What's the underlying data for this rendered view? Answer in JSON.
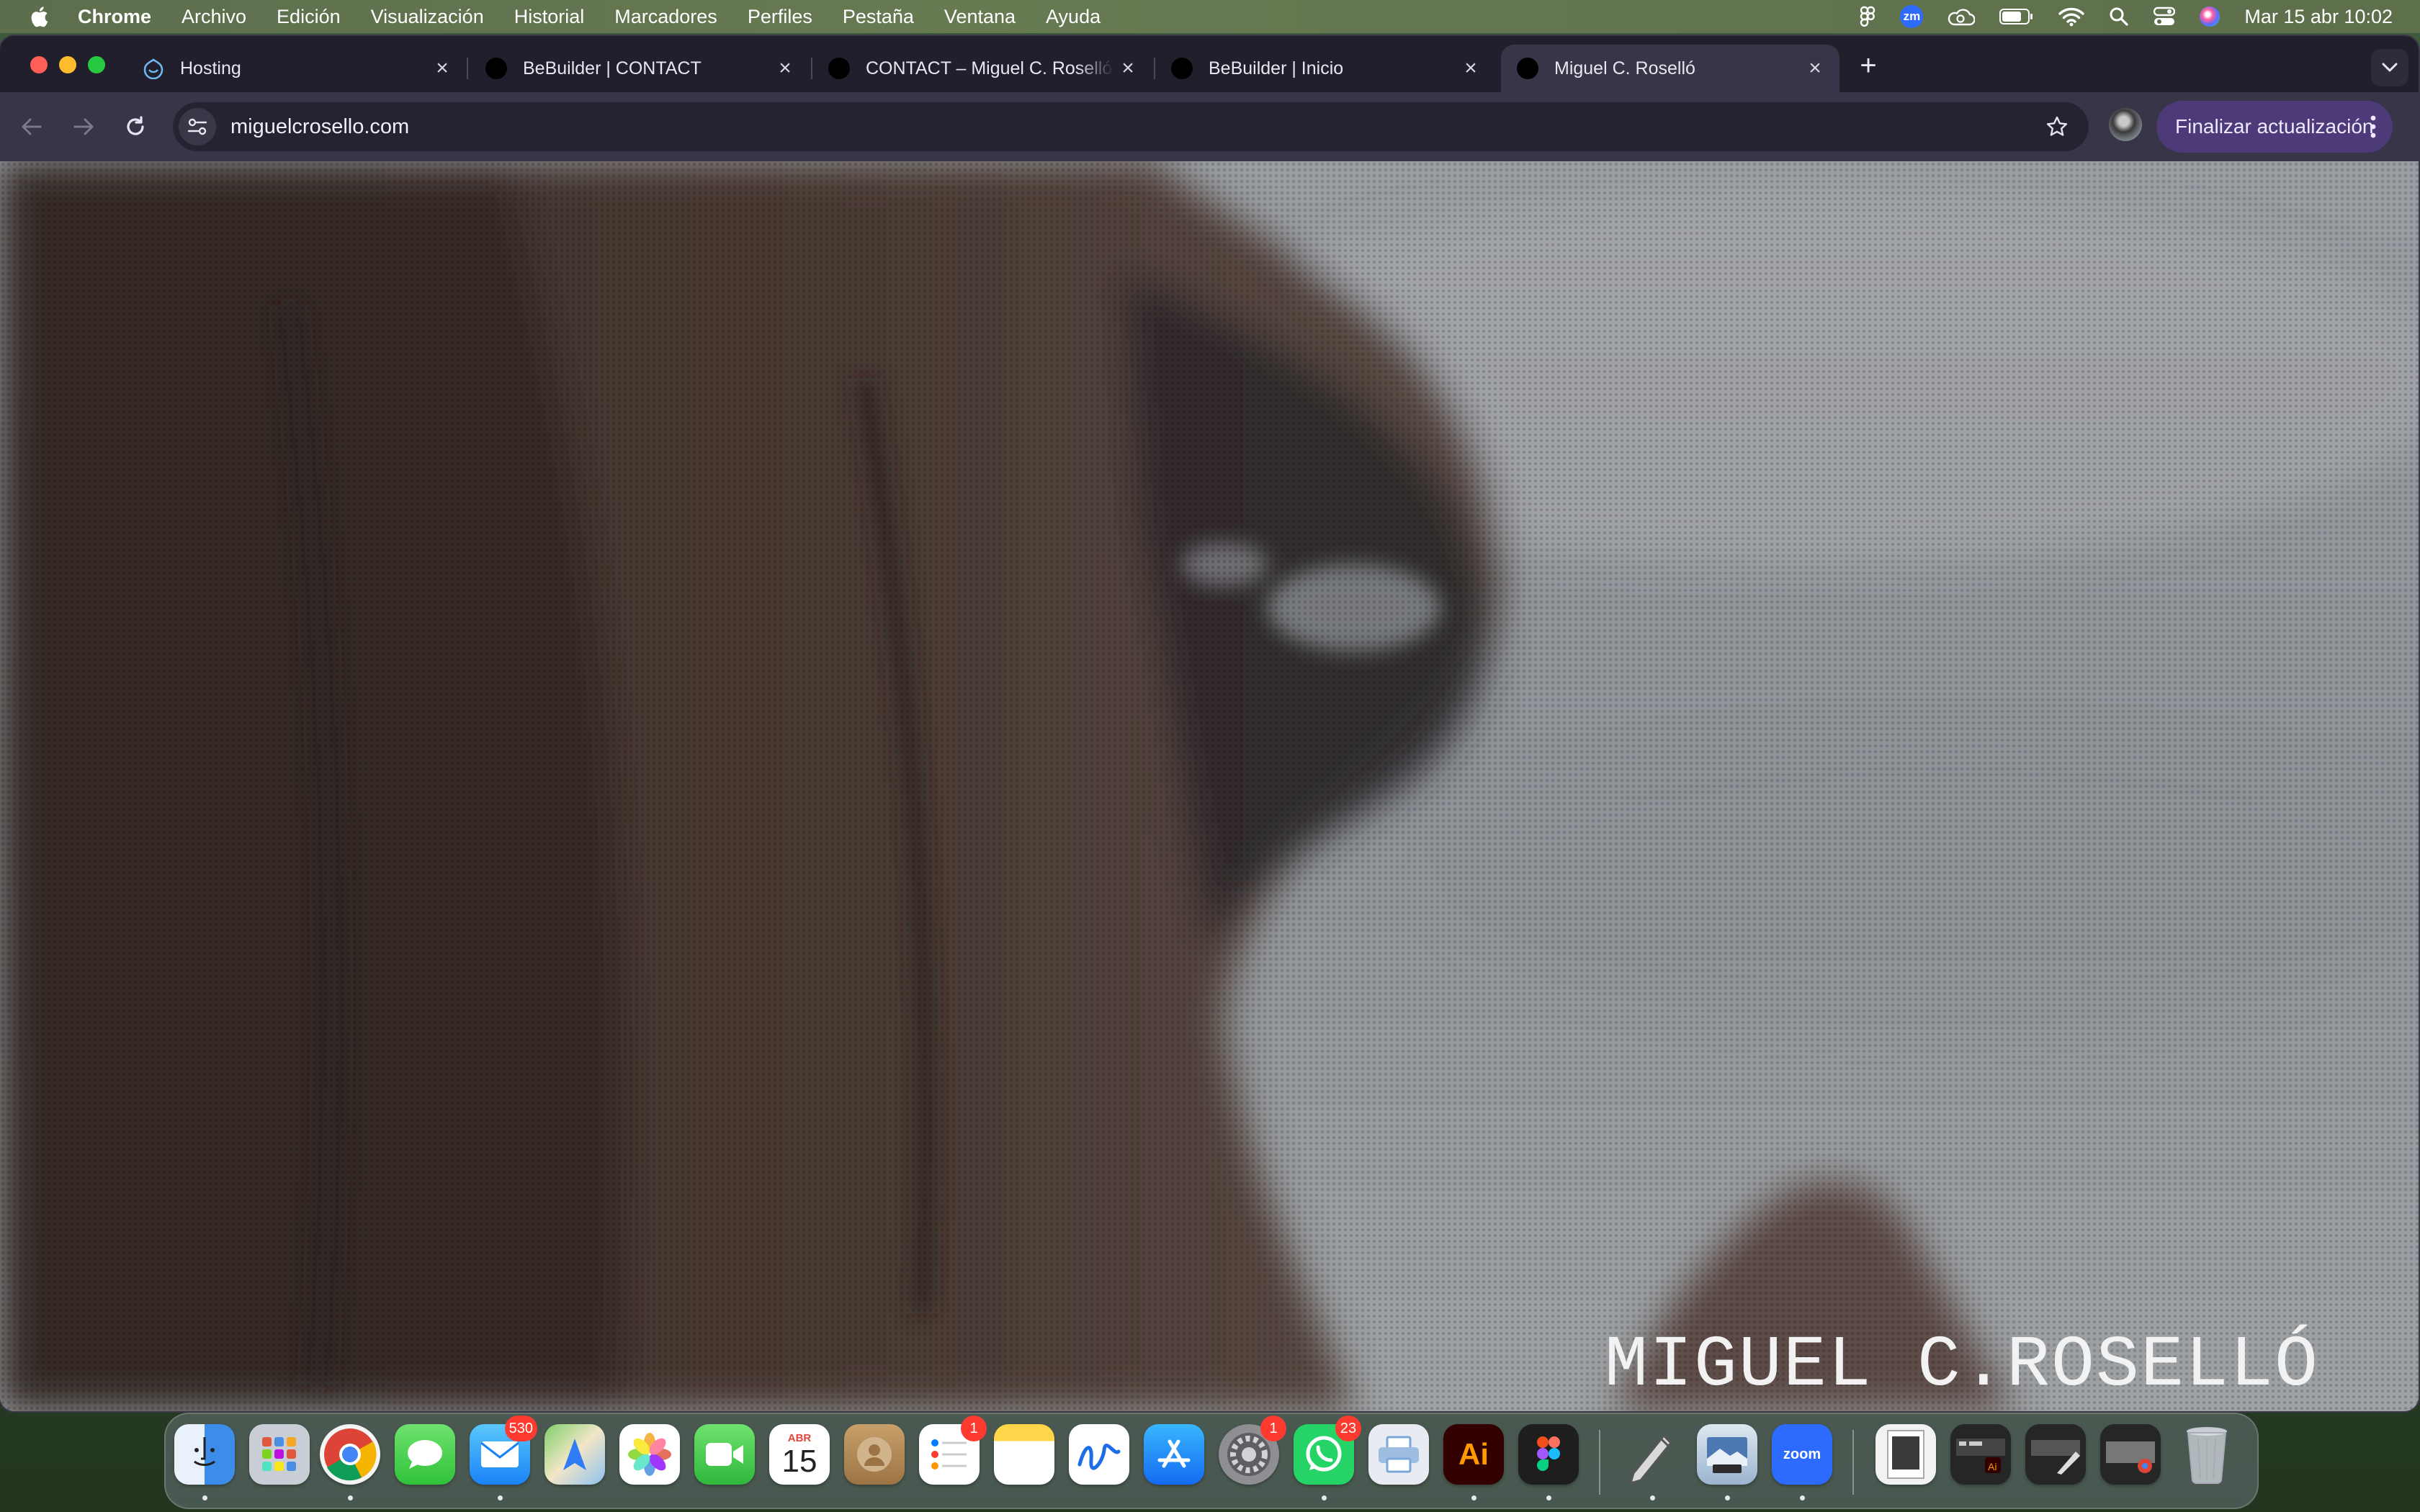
{
  "menubar": {
    "app_name": "Chrome",
    "items": [
      "Archivo",
      "Edición",
      "Visualización",
      "Historial",
      "Marcadores",
      "Perfiles",
      "Pestaña",
      "Ventana",
      "Ayuda"
    ],
    "clock": "Mar 15 abr 10:02",
    "status_icons": [
      "figma-icon",
      "zoom-icon",
      "creative-cloud-icon",
      "battery-icon",
      "wifi-icon",
      "spotlight-icon",
      "control-center-icon",
      "siri-icon"
    ],
    "zoom_label": "zm"
  },
  "tabs": [
    {
      "title": "Hosting",
      "icon": "hosting-favicon",
      "active": false
    },
    {
      "title": "BeBuilder | CONTACT",
      "icon": "circle-favicon",
      "active": false
    },
    {
      "title": "CONTACT – Miguel C. Roselló",
      "icon": "circle-favicon",
      "active": false
    },
    {
      "title": "BeBuilder | Inicio",
      "icon": "circle-favicon",
      "active": false
    },
    {
      "title": "Miguel C. Roselló",
      "icon": "circle-favicon",
      "active": true
    }
  ],
  "toolbar": {
    "url": "miguelcrosello.com",
    "update_label": "Finalizar actualización"
  },
  "page": {
    "site_name": "MIGUEL C.ROSELLÓ"
  },
  "dock": {
    "calendar_month": "ABR",
    "calendar_day": "15",
    "illustrator_label": "Ai",
    "zoom_label": "zoom",
    "apps": [
      {
        "name": "Finder",
        "badge": ""
      },
      {
        "name": "Launchpad",
        "badge": ""
      },
      {
        "name": "Google Chrome",
        "badge": ""
      },
      {
        "name": "Messages",
        "badge": ""
      },
      {
        "name": "Mail",
        "badge": "530"
      },
      {
        "name": "Maps",
        "badge": ""
      },
      {
        "name": "Photos",
        "badge": ""
      },
      {
        "name": "FaceTime",
        "badge": ""
      },
      {
        "name": "Calendar",
        "badge": ""
      },
      {
        "name": "Contacts",
        "badge": ""
      },
      {
        "name": "Reminders",
        "badge": "1"
      },
      {
        "name": "Notes",
        "badge": ""
      },
      {
        "name": "Freeform",
        "badge": ""
      },
      {
        "name": "App Store",
        "badge": ""
      },
      {
        "name": "System Settings",
        "badge": "1"
      },
      {
        "name": "WhatsApp",
        "badge": "23"
      },
      {
        "name": "Printer",
        "badge": ""
      },
      {
        "name": "Adobe Illustrator",
        "badge": ""
      },
      {
        "name": "Figma",
        "badge": ""
      },
      {
        "name": "Script Editor",
        "badge": ""
      },
      {
        "name": "Preview",
        "badge": ""
      },
      {
        "name": "Zoom",
        "badge": ""
      },
      {
        "name": "Document",
        "badge": ""
      },
      {
        "name": "Recent Items 1",
        "badge": ""
      },
      {
        "name": "Recent Items 2",
        "badge": ""
      },
      {
        "name": "Recent Items 3",
        "badge": ""
      },
      {
        "name": "Trash",
        "badge": ""
      }
    ]
  }
}
